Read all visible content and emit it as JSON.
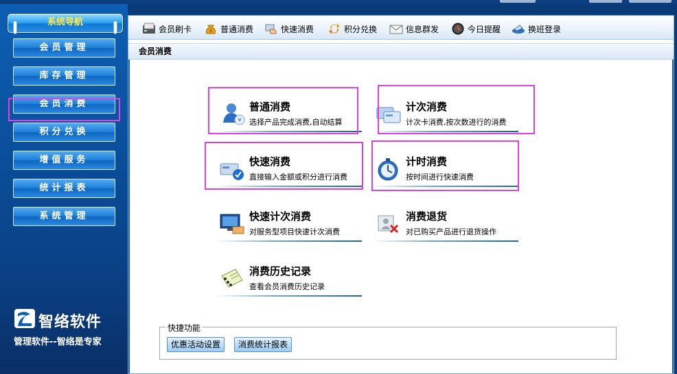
{
  "sidebar": {
    "title": "系统导航",
    "items": [
      {
        "label": "会员管理",
        "name": "sidebar-item-member-management"
      },
      {
        "label": "库存管理",
        "name": "sidebar-item-inventory-management"
      },
      {
        "label": "会员消费",
        "name": "sidebar-item-member-consumption"
      },
      {
        "label": "积分兑换",
        "name": "sidebar-item-points-exchange"
      },
      {
        "label": "增值服务",
        "name": "sidebar-item-value-added-services"
      },
      {
        "label": "统计报表",
        "name": "sidebar-item-statistics-reports"
      },
      {
        "label": "系统管理",
        "name": "sidebar-item-system-management"
      }
    ],
    "selected_index": 2,
    "logo_name": "智络软件",
    "slogan": "管理软件--智络是专家"
  },
  "toolbar": {
    "items": [
      {
        "label": "会员刷卡",
        "icon": "card-reader-icon"
      },
      {
        "label": "普通消费",
        "icon": "money-bag-icon"
      },
      {
        "label": "快速消费",
        "icon": "fast-hand-icon"
      },
      {
        "label": "积分兑换",
        "icon": "exchange-arrows-icon"
      },
      {
        "label": "信息群发",
        "icon": "envelope-icon"
      },
      {
        "label": "今日提醒",
        "icon": "clock-icon"
      },
      {
        "label": "换班登录",
        "icon": "shift-login-icon"
      }
    ]
  },
  "section_title": "会员消费",
  "cards": [
    {
      "title": "普通消费",
      "desc": "选择产品完成消费,自动结算",
      "icon": "customer-icon"
    },
    {
      "title": "计次消费",
      "desc": "计次卡消费,按次数进行的消费",
      "icon": "cards-icon"
    },
    {
      "title": "快速消费",
      "desc": "直接输入金额或积分进行消费",
      "icon": "quick-card-icon"
    },
    {
      "title": "计时消费",
      "desc": "按时间进行快速消费",
      "icon": "stopwatch-icon"
    },
    {
      "title": "快速计次消费",
      "desc": "对服务型项目快速计次消费",
      "icon": "monitor-icon"
    },
    {
      "title": "消费退货",
      "desc": "对已购买产品进行退货操作",
      "icon": "return-icon"
    },
    {
      "title": "消费历史记录",
      "desc": "查看会员消费历史记录",
      "icon": "notebook-icon"
    }
  ],
  "shortcuts": {
    "legend": "快捷功能",
    "buttons": [
      "优惠活动设置",
      "消费统计报表"
    ]
  },
  "colors": {
    "highlight": "#e040e0",
    "sidebar_bg": "#0a4f9c",
    "nav_title_text": "#ffe94a"
  }
}
